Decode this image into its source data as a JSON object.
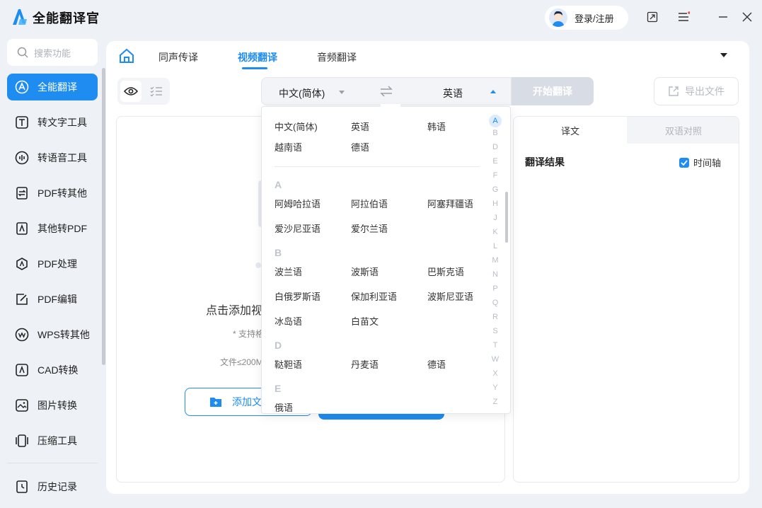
{
  "app": {
    "title": "全能翻译官",
    "login_label": "登录/注册"
  },
  "sidebar": {
    "search_placeholder": "搜索功能",
    "items": [
      {
        "label": "全能翻译",
        "icon": "translate-icon",
        "active": true
      },
      {
        "label": "转文字工具",
        "icon": "text-tool-icon"
      },
      {
        "label": "转语音工具",
        "icon": "audio-wave-icon"
      },
      {
        "label": "PDF转其他",
        "icon": "pdf-convert-icon"
      },
      {
        "label": "其他转PDF",
        "icon": "to-pdf-icon"
      },
      {
        "label": "PDF处理",
        "icon": "pdf-process-icon"
      },
      {
        "label": "PDF编辑",
        "icon": "pdf-edit-icon"
      },
      {
        "label": "WPS转其他",
        "icon": "wps-icon"
      },
      {
        "label": "CAD转换",
        "icon": "cad-icon"
      },
      {
        "label": "图片转换",
        "icon": "image-icon"
      },
      {
        "label": "压缩工具",
        "icon": "compress-icon"
      }
    ],
    "history_label": "历史记录"
  },
  "tabs": [
    {
      "label": "同声传译"
    },
    {
      "label": "视频翻译",
      "active": true
    },
    {
      "label": "音频翻译"
    }
  ],
  "toolbar": {
    "source_lang": "中文(简体)",
    "target_lang": "英语",
    "start_label": "开始翻译",
    "export_label": "导出文件"
  },
  "upload": {
    "title": "点击添加视",
    "note": "* 支持格",
    "limit": "文件≤200M",
    "add_label": "添加文"
  },
  "result": {
    "tab_translation": "译文",
    "tab_bilingual": "双语对照",
    "title": "翻译结果",
    "timeline_label": "时间轴"
  },
  "dropdown": {
    "common": [
      "中文(简体)",
      "英语",
      "韩语",
      "越南语",
      "德语"
    ],
    "groups": [
      {
        "letter": "A",
        "langs": [
          "阿姆哈拉语",
          "阿拉伯语",
          "阿塞拜疆语",
          "爱沙尼亚语",
          "爱尔兰语"
        ]
      },
      {
        "letter": "B",
        "langs": [
          "波兰语",
          "波斯语",
          "巴斯克语",
          "白俄罗斯语",
          "保加利亚语",
          "波斯尼亚语",
          "冰岛语",
          "白苗文"
        ]
      },
      {
        "letter": "D",
        "langs": [
          "鞑靼语",
          "丹麦语",
          "德语"
        ]
      },
      {
        "letter": "E",
        "langs": [
          "俄语"
        ]
      }
    ],
    "alphabet": [
      "A",
      "B",
      "D",
      "E",
      "F",
      "G",
      "H",
      "J",
      "K",
      "L",
      "M",
      "N",
      "P",
      "Q",
      "R",
      "S",
      "T",
      "W",
      "X",
      "Y",
      "Z"
    ],
    "active_letter": "A"
  },
  "colors": {
    "accent": "#1e8cf0",
    "background": "#eef1f6"
  }
}
